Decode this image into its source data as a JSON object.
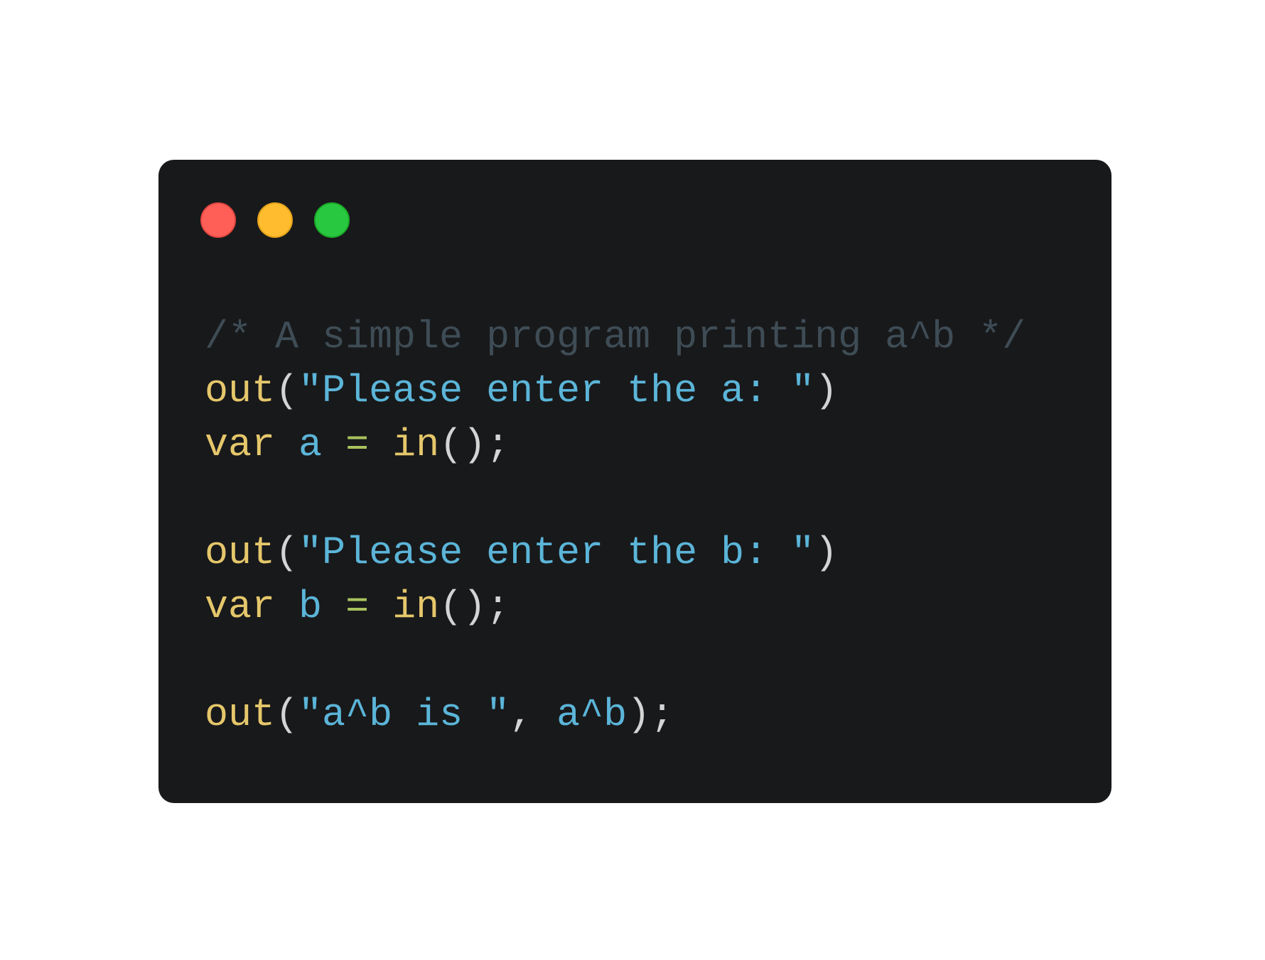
{
  "colors": {
    "page_background": "#ffffff",
    "window_background": "#18191b",
    "close": "#ff5f57",
    "minimize": "#febc2e",
    "zoom": "#28c840",
    "comment": "#3e4c55",
    "function": "#e5c76b",
    "keyword": "#e5c76b",
    "string": "#5bb5d8",
    "identifier": "#5bb5d8",
    "operator": "#a8c25e",
    "punctuation": "#d4d4d4"
  },
  "window_controls": [
    {
      "name": "close",
      "icon": "red-circle-icon"
    },
    {
      "name": "minimize",
      "icon": "yellow-circle-icon"
    },
    {
      "name": "zoom",
      "icon": "green-circle-icon"
    }
  ],
  "code": {
    "line_1": {
      "comment": "/* A simple program printing a^b */"
    },
    "line_2": {
      "fn": "out",
      "open": "(",
      "str": "\"Please enter the a: \"",
      "close": ")"
    },
    "line_3": {
      "kw": "var",
      "ident": "a",
      "op": "=",
      "fn": "in",
      "rest": "();"
    },
    "line_4": {},
    "line_5": {
      "fn": "out",
      "open": "(",
      "str": "\"Please enter the b: \"",
      "close": ")"
    },
    "line_6": {
      "kw": "var",
      "ident": "b",
      "op": "=",
      "fn": "in",
      "rest": "();"
    },
    "line_7": {},
    "line_8": {
      "fn": "out",
      "open": "(",
      "str": "\"a^b is \"",
      "comma": ",",
      "expr": "a^b",
      "rest": ");"
    }
  }
}
